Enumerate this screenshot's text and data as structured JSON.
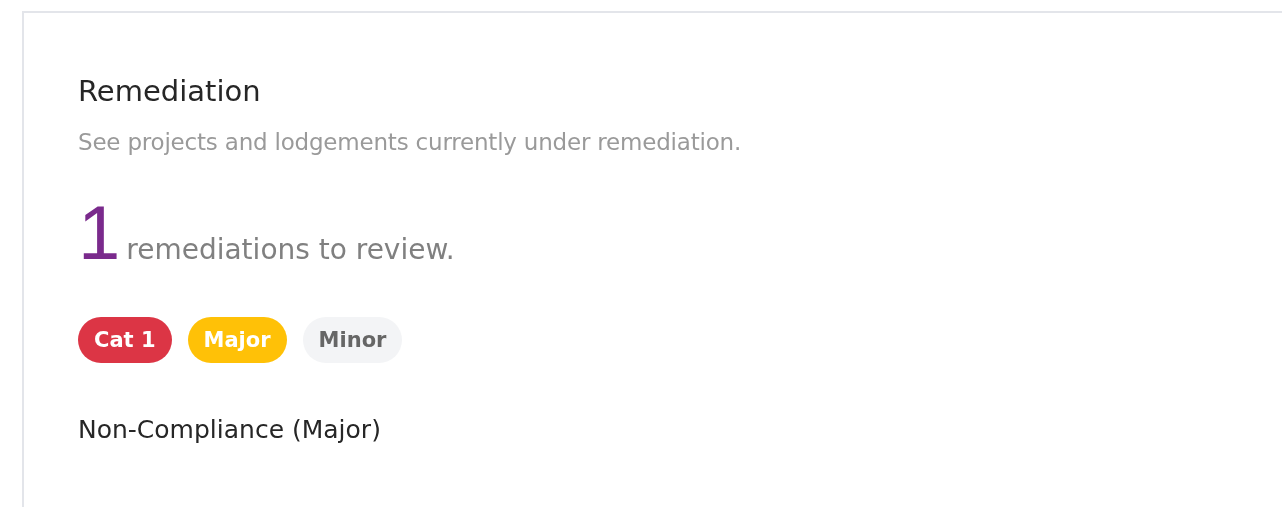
{
  "section": {
    "title": "Remediation",
    "subtitle": "See projects and lodgements currently under remediation."
  },
  "summary": {
    "count": "1",
    "text": "remediations to review."
  },
  "tags": [
    {
      "label": "Cat 1",
      "color": "#dc3545",
      "kind": "filled"
    },
    {
      "label": "Major",
      "color": "#ffc107",
      "kind": "filled"
    },
    {
      "label": "Minor",
      "color": "#f3f4f6",
      "kind": "plain"
    }
  ],
  "group_heading": "Non-Compliance (Major)"
}
